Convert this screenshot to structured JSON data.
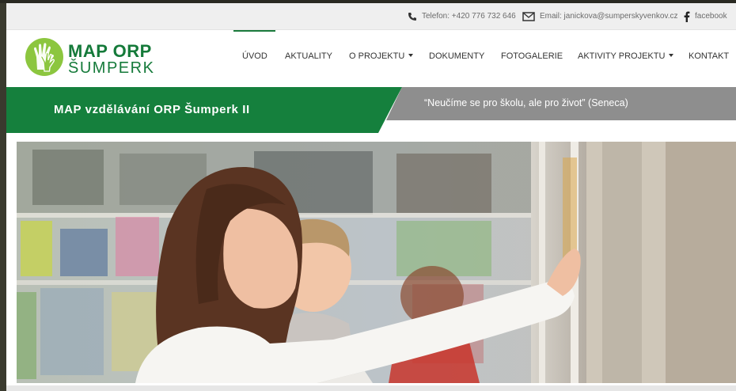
{
  "topbar": {
    "phone": "Telefon: +420 776 732 646",
    "email": "Email: janickova@sumperskyvenkov.cz",
    "facebook": "facebook"
  },
  "logo": {
    "line1": "MAP ORP",
    "line2": "ŠUMPERK"
  },
  "nav": {
    "items": [
      {
        "label": "ÚVOD"
      },
      {
        "label": "AKTUALITY"
      },
      {
        "label": "O PROJEKTU"
      },
      {
        "label": "DOKUMENTY"
      },
      {
        "label": "FOTOGALERIE"
      },
      {
        "label": "AKTIVITY PROJEKTU"
      },
      {
        "label": "KONTAKT"
      }
    ]
  },
  "banner": {
    "title": "MAP vzdělávání ORP Šumperk II",
    "quote": "“Neučíme se pro školu, ale pro život” (Seneca)"
  },
  "colors": {
    "brand_green": "#15803d",
    "logo_lime": "#8cc63f",
    "banner_gray": "#8e8e8e"
  }
}
